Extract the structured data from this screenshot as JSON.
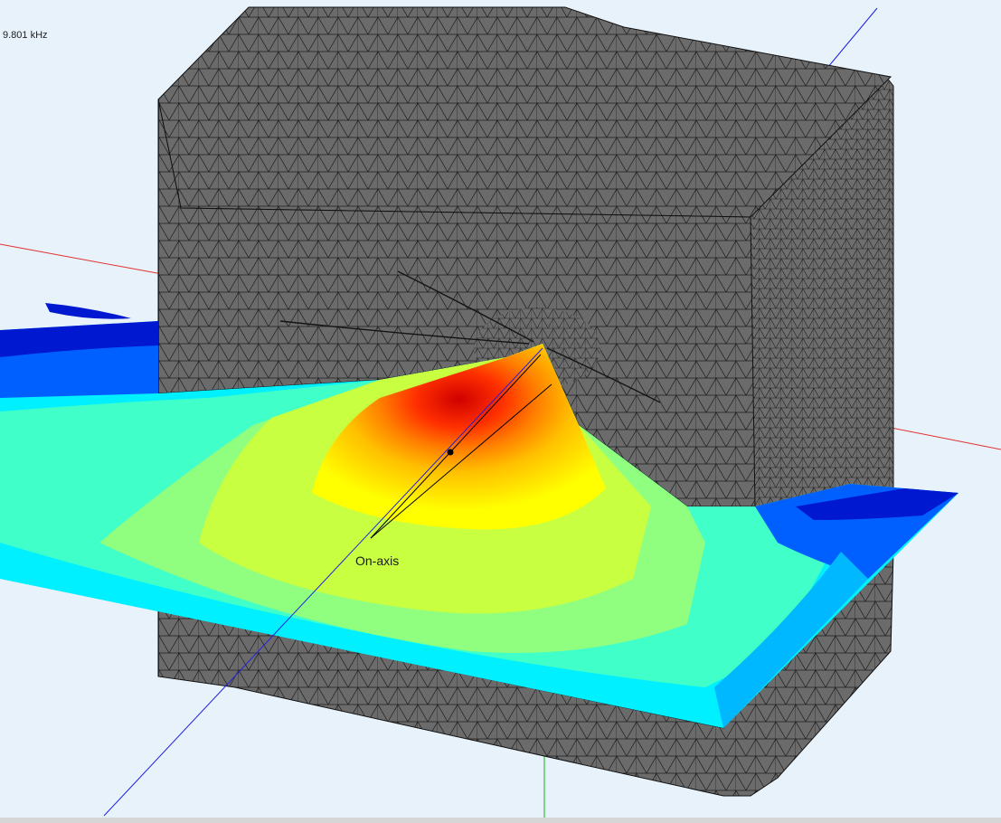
{
  "viewport": {
    "frequency_readout": "9.801 kHz",
    "probe_label": "On-axis"
  },
  "colors": {
    "background": "#e8f2fb",
    "mesh_fill": "#6b6b6b",
    "mesh_lines": "#1e1e1e",
    "axis_x": "#e23030",
    "axis_y": "#18b018",
    "axis_z": "#2020e0",
    "field_scale": [
      "#00008c",
      "#0018d0",
      "#0060ff",
      "#00b8ff",
      "#00f0ff",
      "#40ffc8",
      "#90ff80",
      "#c8ff40",
      "#ffff00",
      "#ffc000",
      "#ff8000",
      "#ff3000",
      "#d00000"
    ]
  },
  "icons": {
    "probe_point": "probe-dot-icon"
  }
}
